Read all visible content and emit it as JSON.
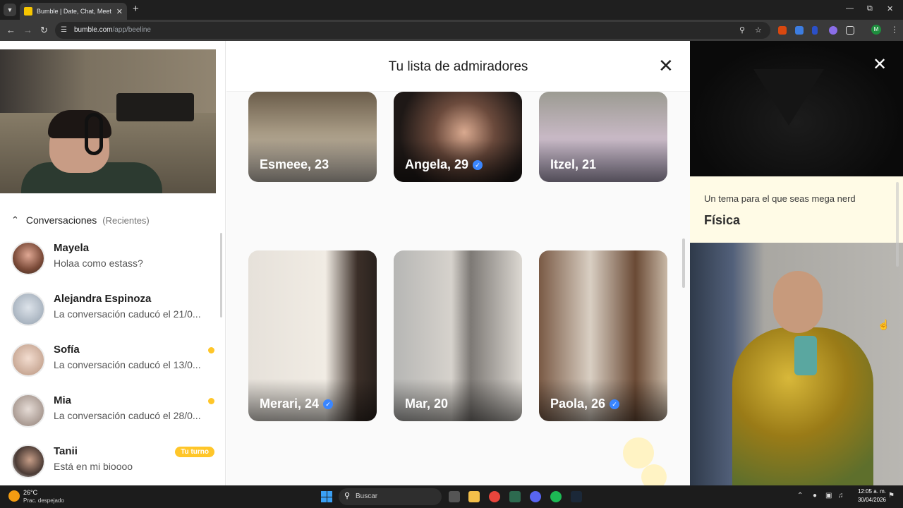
{
  "browser": {
    "tab_title": "Bumble | Date, Chat, Meet New",
    "url_domain": "bumble.com",
    "url_path": "/app/beeline"
  },
  "sidebar": {
    "conversations_title": "Conversaciones",
    "conversations_filter": "(Recientes)",
    "conversations": [
      {
        "name": "Mayela",
        "message": "Holaa como estass?",
        "unread": false,
        "badge": ""
      },
      {
        "name": "Alejandra Espinoza",
        "message": "La conversación caducó el 21/0...",
        "unread": false,
        "badge": ""
      },
      {
        "name": "Sofía",
        "message": "La conversación caducó el 13/0...",
        "unread": true,
        "badge": ""
      },
      {
        "name": "Mia",
        "message": "La conversación caducó el 28/0...",
        "unread": true,
        "badge": ""
      },
      {
        "name": "Tanii",
        "message": "Está en mi bioooo",
        "unread": false,
        "badge": "Tu turno"
      }
    ]
  },
  "modal": {
    "title": "Tu lista de admiradores",
    "cards": [
      {
        "label": "Esmeee, 23",
        "verified": false
      },
      {
        "label": "Angela, 29",
        "verified": true
      },
      {
        "label": "Itzel, 21",
        "verified": false
      },
      {
        "label": "Merari, 24",
        "verified": true
      },
      {
        "label": "Mar, 20",
        "verified": false
      },
      {
        "label": "Paola, 26",
        "verified": true
      }
    ]
  },
  "profile": {
    "prompt_question": "Un tema para el que seas mega nerd",
    "prompt_answer": "Física"
  },
  "taskbar": {
    "temperature": "26°C",
    "weather": "Prac. despejado",
    "search_placeholder": "Buscar",
    "time": "12:05 a. m.",
    "date": "30/04/2026"
  },
  "colors": {
    "bumble_yellow": "#ffc629",
    "verified_blue": "#3a86ff",
    "prompt_bg": "#fffbe6"
  }
}
